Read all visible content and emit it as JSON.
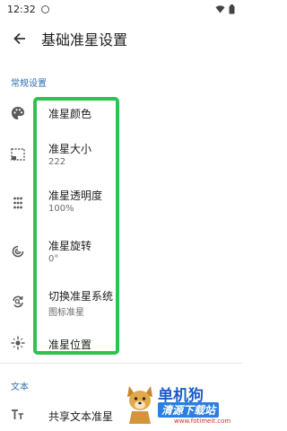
{
  "status_bar": {
    "time": "12:32"
  },
  "app_bar": {
    "title": "基础准星设置",
    "back_icon": "arrow-back-icon"
  },
  "sections": {
    "general": "常规设置",
    "text": "文本"
  },
  "rows": [
    {
      "title": "准星颜色",
      "subtitle": "",
      "icon": "palette-icon"
    },
    {
      "title": "准星大小",
      "subtitle": "222",
      "icon": "resize-icon"
    },
    {
      "title": "准星透明度",
      "subtitle": "100%",
      "icon": "dots-grid-icon"
    },
    {
      "title": "准星旋转",
      "subtitle": "0°",
      "icon": "rotate-icon"
    },
    {
      "title": "切换准星系统",
      "subtitle": "图标准星",
      "icon": "switch-icon"
    },
    {
      "title": "准星位置",
      "subtitle": "",
      "icon": "crosshair-position-icon"
    },
    {
      "title": "共享文本准星",
      "subtitle": "",
      "icon": "text-format-icon"
    }
  ],
  "watermark": {
    "title": "单机狗",
    "subtitle": "清源下载站",
    "url": "www.fotimeit.com"
  },
  "colors": {
    "accent": "#2f6fb0",
    "highlight": "#2ec24f"
  }
}
